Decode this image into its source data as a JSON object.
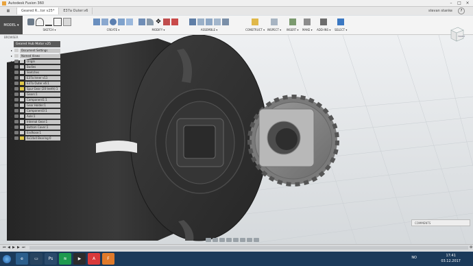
{
  "window": {
    "title": "Autodesk Fusion 360"
  },
  "tabs": [
    {
      "label": "Geared R...tor v25*"
    },
    {
      "label": "E37a Outer:v6"
    }
  ],
  "user": {
    "name": "stevan stanke",
    "help": "?"
  },
  "ribbon": {
    "model": "MODEL ▾",
    "groups": [
      {
        "label": "SKETCH ▾"
      },
      {
        "label": "CREATE ▾"
      },
      {
        "label": "MODIFY ▾"
      },
      {
        "label": "ASSEMBLE ▾"
      },
      {
        "label": "CONSTRUCT ▾"
      },
      {
        "label": "INSPECT ▾"
      },
      {
        "label": "INSERT ▾"
      },
      {
        "label": "MAKE ▾"
      },
      {
        "label": "ADD-INS ▾"
      },
      {
        "label": "SELECT ▾"
      }
    ]
  },
  "browser": {
    "header": "BROWSER",
    "root": "Geared Hub Motor v25",
    "items": [
      {
        "label": "Document Settings"
      },
      {
        "label": "Named Views"
      },
      {
        "label": "Origin"
      },
      {
        "label": "Bodies"
      },
      {
        "label": "Sketches"
      },
      {
        "label": "E37a Inner v11"
      },
      {
        "label": "E37a Outer v6:1"
      },
      {
        "label": "Spur Gear (20 teeth):1"
      },
      {
        "label": "Gears:1"
      },
      {
        "label": "Component1:1"
      },
      {
        "label": "Gear Holder:1"
      },
      {
        "label": "Component3:1"
      },
      {
        "label": "Axle:1"
      },
      {
        "label": "Internal Gear:1"
      },
      {
        "label": "Bottom Cover:1"
      },
      {
        "label": "Endhose:1"
      },
      {
        "label": "6x14x4 Bearing:0"
      }
    ]
  },
  "viewcube": {
    "label": "FRONT"
  },
  "comments": {
    "label": "COMMENTS"
  },
  "taskbar": {
    "language": "NO",
    "time": "17:41",
    "date": "03.12.2017"
  },
  "colors": {
    "accent": "#e8a33d",
    "taskbar": "#1b3a5a",
    "model_body": "#2e2e2e",
    "gear": "#8a8a8a"
  }
}
